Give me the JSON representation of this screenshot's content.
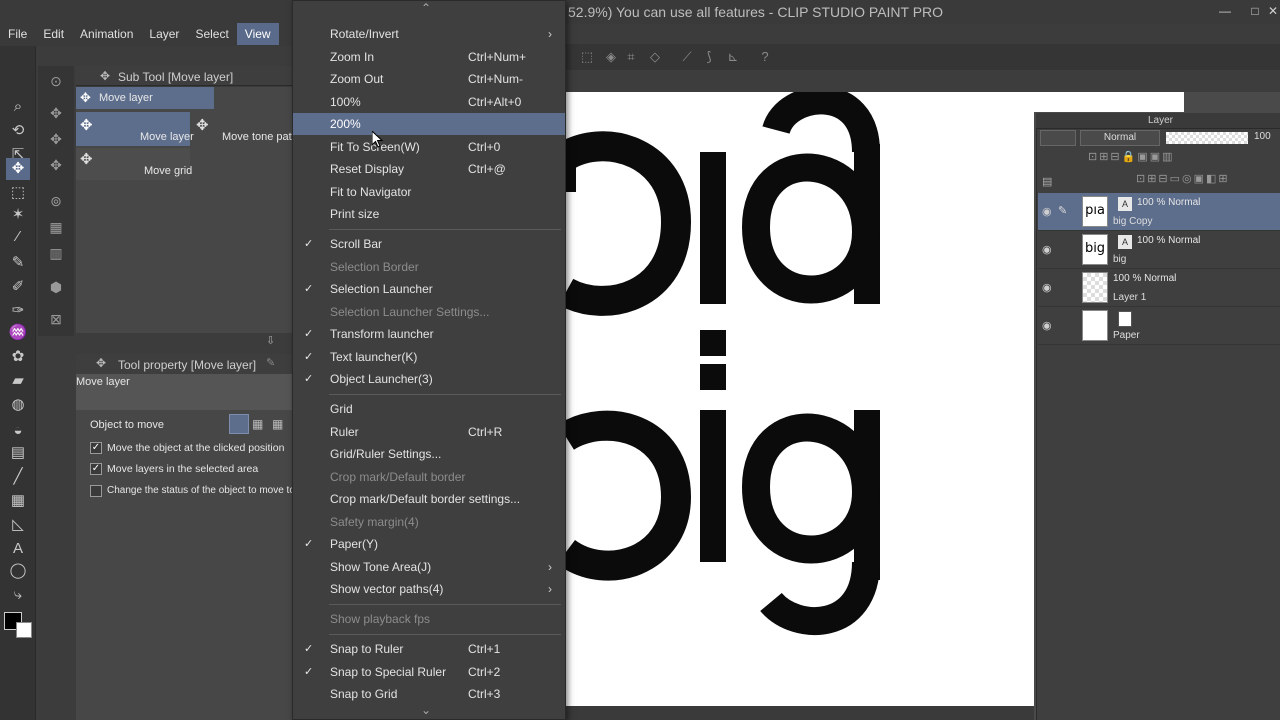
{
  "app": {
    "title": "52.9%)  You can use all features - CLIP STUDIO PAINT PRO",
    "window_buttons": [
      "—",
      "□",
      "✕"
    ]
  },
  "menubar": {
    "items": [
      "File",
      "Edit",
      "Animation",
      "Layer",
      "Select",
      "View"
    ],
    "active": "View"
  },
  "subtool": {
    "title": "Sub Tool [Move layer]",
    "selected": "Move layer",
    "tiles": [
      "Move layer",
      "Move tone patte",
      "Move grid"
    ]
  },
  "toolprop": {
    "title": "Tool property [Move layer]",
    "name": "Move layer",
    "object_to_move_label": "Object to move",
    "options": [
      {
        "label": "Move the object at the clicked position",
        "checked": true
      },
      {
        "label": "Move layers in the selected area",
        "checked": true
      },
      {
        "label": "Change the status of the object to move to selec",
        "checked": false
      }
    ]
  },
  "view_menu": {
    "scroll_up": "⌃",
    "scroll_down": "⌄",
    "items": [
      {
        "label": "Rotate/Invert",
        "submenu": true
      },
      {
        "label": "Zoom In",
        "shortcut": "Ctrl+Num+"
      },
      {
        "label": "Zoom Out",
        "shortcut": "Ctrl+Num-"
      },
      {
        "label": "100%",
        "shortcut": "Ctrl+Alt+0"
      },
      {
        "label": "200%",
        "highlighted": true
      },
      {
        "label": "Fit To Screen(W)",
        "shortcut": "Ctrl+0"
      },
      {
        "label": "Reset Display",
        "shortcut": "Ctrl+@"
      },
      {
        "label": "Fit to Navigator"
      },
      {
        "label": "Print size"
      },
      {
        "label": "Scroll Bar",
        "checked": true
      },
      {
        "label": "Selection Border",
        "disabled": true
      },
      {
        "label": "Selection Launcher",
        "checked": true
      },
      {
        "label": "Selection Launcher Settings...",
        "disabled": true
      },
      {
        "label": "Transform launcher",
        "checked": true
      },
      {
        "label": "Text launcher(K)",
        "checked": true
      },
      {
        "label": "Object Launcher(3)",
        "checked": true
      },
      {
        "label": "Grid"
      },
      {
        "label": "Ruler",
        "shortcut": "Ctrl+R"
      },
      {
        "label": "Grid/Ruler Settings..."
      },
      {
        "label": "Crop mark/Default border",
        "disabled": true
      },
      {
        "label": "Crop mark/Default border settings..."
      },
      {
        "label": "Safety margin(4)",
        "disabled": true
      },
      {
        "label": "Paper(Y)",
        "checked": true
      },
      {
        "label": "Show Tone Area(J)",
        "submenu": true
      },
      {
        "label": "Show vector paths(4)",
        "submenu": true
      },
      {
        "label": "Show playback fps",
        "disabled": true
      },
      {
        "label": "Snap to Ruler",
        "shortcut": "Ctrl+1",
        "checked": true
      },
      {
        "label": "Snap to Special Ruler",
        "shortcut": "Ctrl+2",
        "checked": true
      },
      {
        "label": "Snap to Grid",
        "shortcut": "Ctrl+3"
      }
    ]
  },
  "canvas": {
    "top_text": "pıa",
    "colon": ":",
    "bottom_text": "big"
  },
  "layer_panel": {
    "title": "Layer",
    "blend_mode": "Normal",
    "opacity": "100",
    "layers": [
      {
        "mode": "100 % Normal",
        "name": "big Copy",
        "thumb": "pıa",
        "selected": true,
        "text": true
      },
      {
        "mode": "100 % Normal",
        "name": "big",
        "thumb": "big",
        "text": true
      },
      {
        "mode": "100 % Normal",
        "name": "Layer 1",
        "thumb": ""
      },
      {
        "mode": "",
        "name": "Paper",
        "thumb": ""
      }
    ]
  },
  "colors": {
    "highlight": "#5d6d8c",
    "menu_bg": "#3f3f3f",
    "canvas": "#ffffff"
  }
}
